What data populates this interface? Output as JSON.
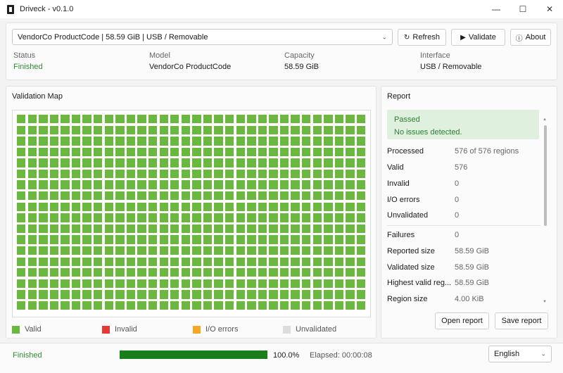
{
  "window": {
    "title": "Driveck - v0.1.0",
    "controls": {
      "minimize": "—",
      "maximize": "☐",
      "close": "✕"
    }
  },
  "toolbar": {
    "drive_selected": "VendorCo ProductCode | 58.59 GiB | USB / Removable",
    "refresh_label": "Refresh",
    "validate_label": "Validate",
    "about_label": "About"
  },
  "drive_info": {
    "status": {
      "label": "Status",
      "value": "Finished"
    },
    "model": {
      "label": "Model",
      "value": "VendorCo ProductCode"
    },
    "capacity": {
      "label": "Capacity",
      "value": "58.59 GiB"
    },
    "interface": {
      "label": "Interface",
      "value": "USB / Removable"
    }
  },
  "map": {
    "title": "Validation Map",
    "total_regions": 576,
    "valid_regions": 576,
    "legend": [
      {
        "label": "Valid",
        "color": "#6ab840"
      },
      {
        "label": "Invalid",
        "color": "#e53935"
      },
      {
        "label": "I/O errors",
        "color": "#f5a623"
      },
      {
        "label": "Unvalidated",
        "color": "#dcdcdc"
      }
    ]
  },
  "report": {
    "title": "Report",
    "status_title": "Passed",
    "status_message": "No issues detected.",
    "rows": [
      {
        "key": "Processed",
        "value": "576 of 576 regions"
      },
      {
        "key": "Valid",
        "value": "576"
      },
      {
        "key": "Invalid",
        "value": "0"
      },
      {
        "key": "I/O errors",
        "value": "0"
      },
      {
        "key": "Unvalidated",
        "value": "0"
      },
      {
        "key": "Failures",
        "value": "0"
      },
      {
        "key": "Reported size",
        "value": "58.59 GiB"
      },
      {
        "key": "Validated size",
        "value": "58.59 GiB"
      },
      {
        "key": "Highest valid reg...",
        "value": "58.59 GiB"
      },
      {
        "key": "Region size",
        "value": "4.00 KiB"
      }
    ],
    "open_report_label": "Open report",
    "save_report_label": "Save report"
  },
  "status_bar": {
    "status": "Finished",
    "progress_fraction": 1.0,
    "percent_text": "100.0%",
    "elapsed": "Elapsed: 00:00:08",
    "language": "English"
  }
}
